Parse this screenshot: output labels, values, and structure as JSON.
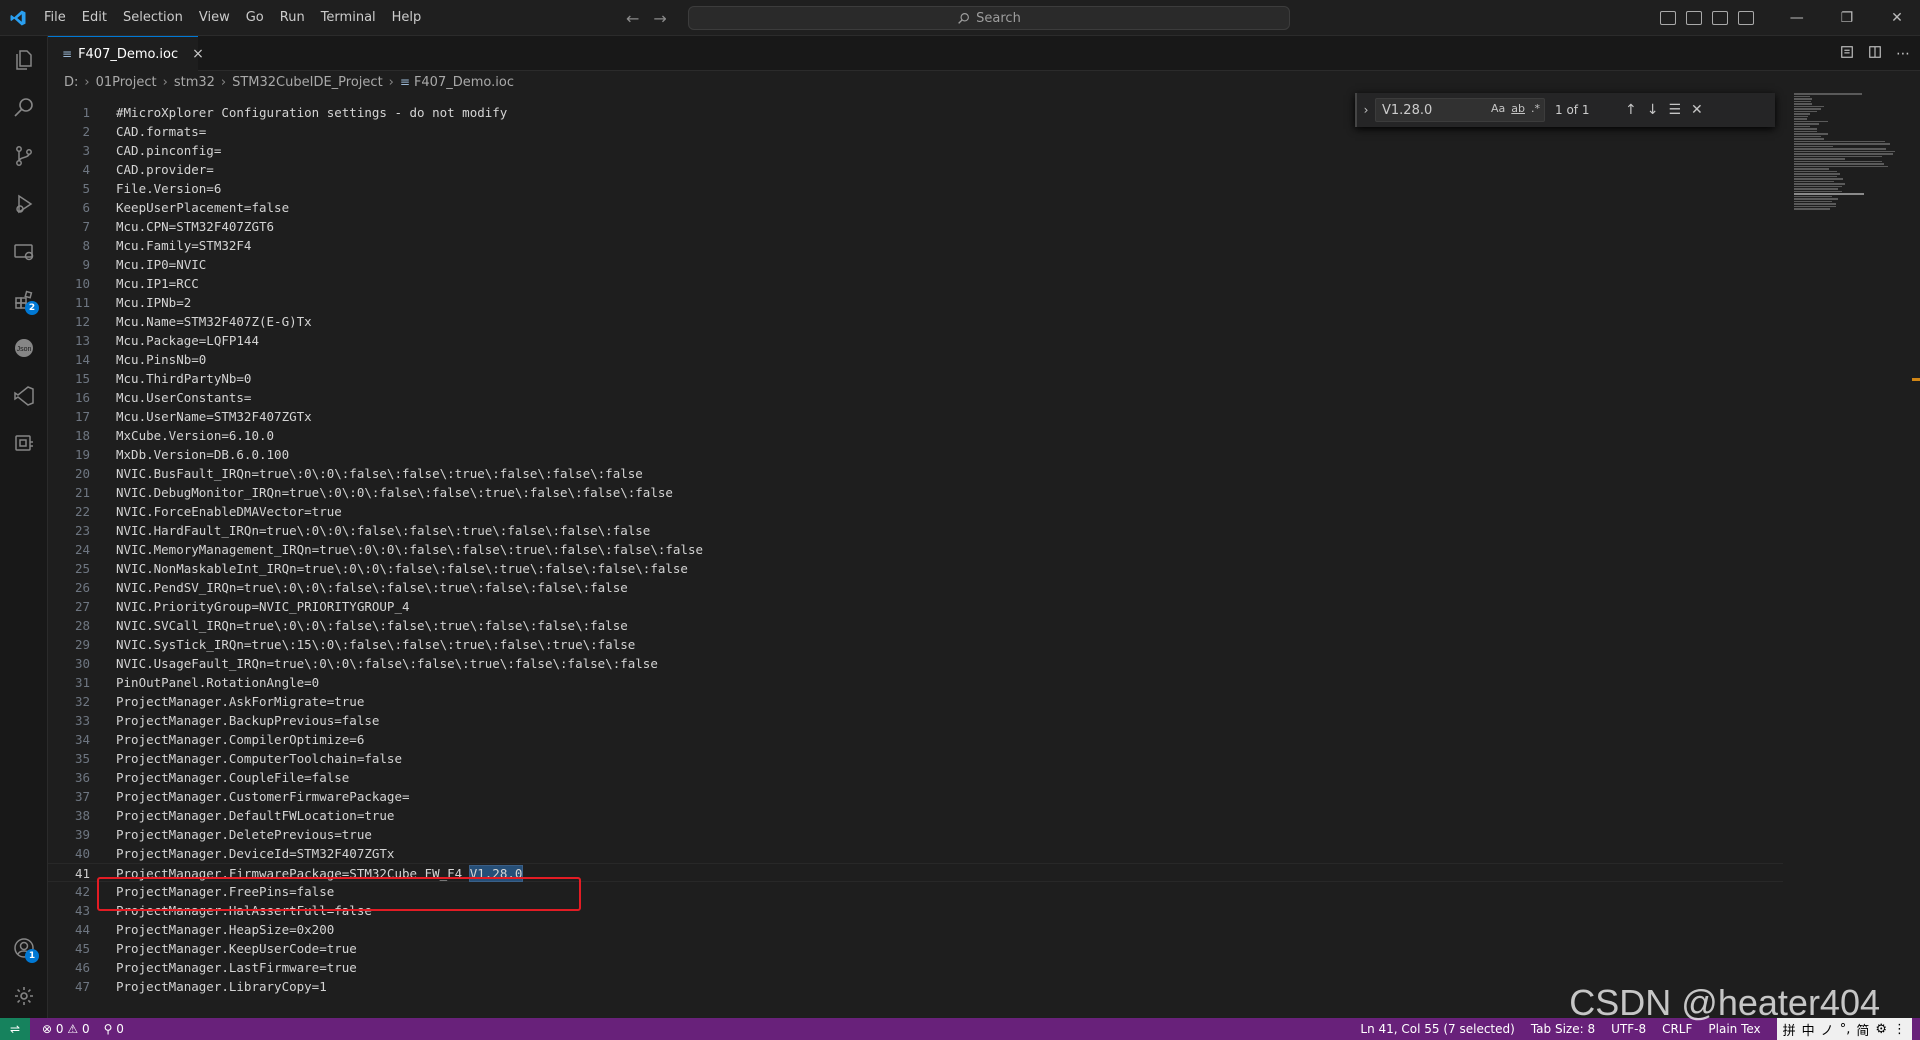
{
  "titlebar": {
    "menu": [
      "File",
      "Edit",
      "Selection",
      "View",
      "Go",
      "Run",
      "Terminal",
      "Help"
    ],
    "search_placeholder": "Search"
  },
  "activity_bar": {
    "extensions_badge": "2",
    "accounts_badge": "1"
  },
  "tab": {
    "label": "F407_Demo.ioc",
    "close_glyph": "×"
  },
  "breadcrumb": [
    "D:",
    "01Project",
    "stm32",
    "STM32CubeIDE_Project",
    "F407_Demo.ioc"
  ],
  "find": {
    "value": "V1.28.0",
    "match_case": "Aa",
    "whole_word": "ab",
    "regex": ".*",
    "count": "1 of 1"
  },
  "editor": {
    "current_line": 41,
    "selected_text": "V1.28.0",
    "lines": [
      "#MicroXplorer Configuration settings - do not modify",
      "CAD.formats=",
      "CAD.pinconfig=",
      "CAD.provider=",
      "File.Version=6",
      "KeepUserPlacement=false",
      "Mcu.CPN=STM32F407ZGT6",
      "Mcu.Family=STM32F4",
      "Mcu.IP0=NVIC",
      "Mcu.IP1=RCC",
      "Mcu.IPNb=2",
      "Mcu.Name=STM32F407Z(E-G)Tx",
      "Mcu.Package=LQFP144",
      "Mcu.PinsNb=0",
      "Mcu.ThirdPartyNb=0",
      "Mcu.UserConstants=",
      "Mcu.UserName=STM32F407ZGTx",
      "MxCube.Version=6.10.0",
      "MxDb.Version=DB.6.0.100",
      "NVIC.BusFault_IRQn=true\\:0\\:0\\:false\\:false\\:true\\:false\\:false\\:false",
      "NVIC.DebugMonitor_IRQn=true\\:0\\:0\\:false\\:false\\:true\\:false\\:false\\:false",
      "NVIC.ForceEnableDMAVector=true",
      "NVIC.HardFault_IRQn=true\\:0\\:0\\:false\\:false\\:true\\:false\\:false\\:false",
      "NVIC.MemoryManagement_IRQn=true\\:0\\:0\\:false\\:false\\:true\\:false\\:false\\:false",
      "NVIC.NonMaskableInt_IRQn=true\\:0\\:0\\:false\\:false\\:true\\:false\\:false\\:false",
      "NVIC.PendSV_IRQn=true\\:0\\:0\\:false\\:false\\:true\\:false\\:false\\:false",
      "NVIC.PriorityGroup=NVIC_PRIORITYGROUP_4",
      "NVIC.SVCall_IRQn=true\\:0\\:0\\:false\\:false\\:true\\:false\\:false\\:false",
      "NVIC.SysTick_IRQn=true\\:15\\:0\\:false\\:false\\:true\\:false\\:true\\:false",
      "NVIC.UsageFault_IRQn=true\\:0\\:0\\:false\\:false\\:true\\:false\\:false\\:false",
      "PinOutPanel.RotationAngle=0",
      "ProjectManager.AskForMigrate=true",
      "ProjectManager.BackupPrevious=false",
      "ProjectManager.CompilerOptimize=6",
      "ProjectManager.ComputerToolchain=false",
      "ProjectManager.CoupleFile=false",
      "ProjectManager.CustomerFirmwarePackage=",
      "ProjectManager.DefaultFWLocation=true",
      "ProjectManager.DeletePrevious=true",
      "ProjectManager.DeviceId=STM32F407ZGTx",
      "ProjectManager.FirmwarePackage=STM32Cube FW_F4 V1.28.0",
      "ProjectManager.FreePins=false",
      "ProjectManager.HalAssertFull=false",
      "ProjectManager.HeapSize=0x200",
      "ProjectManager.KeepUserCode=true",
      "ProjectManager.LastFirmware=true",
      "ProjectManager.LibraryCopy=1"
    ]
  },
  "statusbar": {
    "errors": "0",
    "warnings": "0",
    "ports": "0",
    "cursor": "Ln 41, Col 55 (7 selected)",
    "tab_size": "Tab Size: 8",
    "encoding": "UTF-8",
    "eol": "CRLF",
    "language": "Plain Tex",
    "ime": [
      "拼",
      "中",
      "ノ",
      "°,",
      "简",
      "⚙",
      "⋮"
    ]
  },
  "watermark": "CSDN @heater404",
  "colors": {
    "accent": "#0078d4",
    "statusbar": "#68217a",
    "selection": "#264f78",
    "annotation": "#e31c24"
  }
}
